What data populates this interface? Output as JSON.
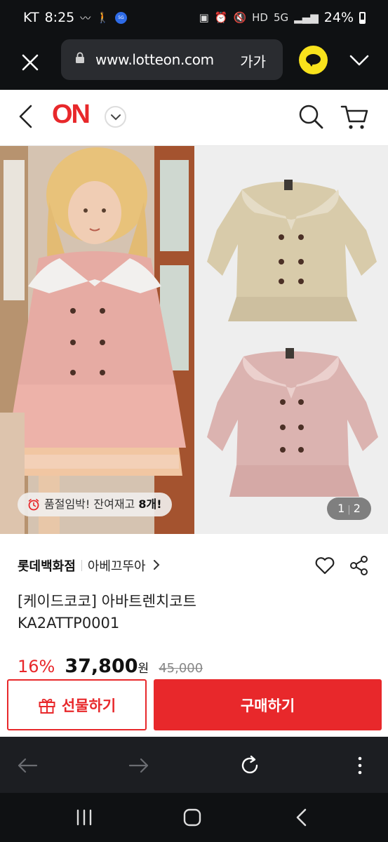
{
  "status_bar": {
    "carrier": "KT",
    "time": "8:25",
    "super_badge": "super 5G",
    "network": "5G",
    "battery": "24%"
  },
  "browser": {
    "url": "www.lotteon.com",
    "text_size_label": "가가",
    "icons": [
      "close-icon",
      "lock-icon",
      "kakaotalk-icon",
      "chevron-down-icon"
    ]
  },
  "header": {
    "logo": "ON",
    "icons": [
      "back-icon",
      "chevron-down-icon",
      "search-icon",
      "cart-icon"
    ]
  },
  "gallery": {
    "stock_badge_prefix": "품절임박! 잔여재고 ",
    "stock_badge_count": "8개!",
    "page_current": "1",
    "page_total": "2"
  },
  "product": {
    "store": "롯데백화점",
    "brand": "아베끄뚜아",
    "name": "[케이드코코] 아바트렌치코트",
    "code": "KA2ATTP0001",
    "discount": "16%",
    "price": "37,800",
    "currency": "원",
    "original_price": "45,000"
  },
  "actions": {
    "gift_label": "선물하기",
    "buy_label": "구매하기"
  },
  "colors": {
    "brand_red": "#e8282b",
    "kakao_yellow": "#f8e21c",
    "coat_beige": "#d8cbaa",
    "coat_pink": "#dbb3b0"
  }
}
